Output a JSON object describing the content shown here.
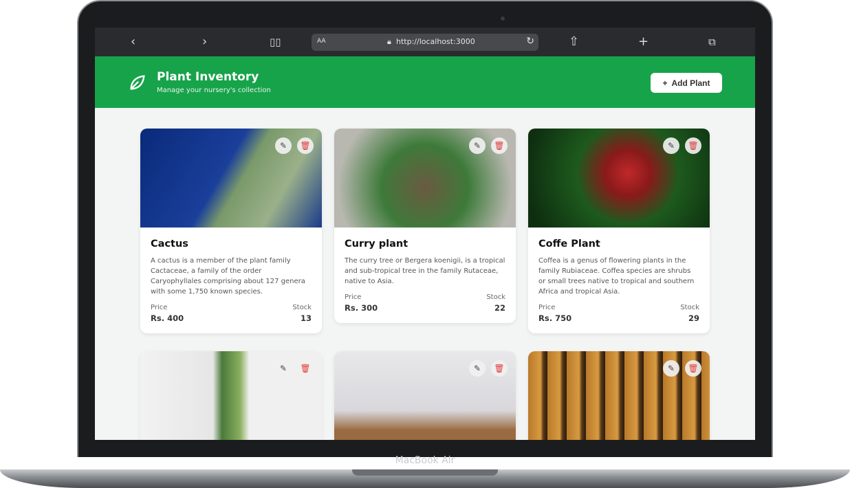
{
  "device": {
    "label": "MacBook Air"
  },
  "browser": {
    "url": "http://localhost:3000",
    "reader_label": "AA"
  },
  "header": {
    "title": "Plant Inventory",
    "subtitle": "Manage your nursery's collection",
    "add_label": "Add Plant"
  },
  "plants": [
    {
      "name": "Cactus",
      "description": "A cactus is a member of the plant family Cactaceae, a family of the order Caryophyllales comprising about 127 genera with some 1,750 known species.",
      "price_label": "Price",
      "price": "Rs. 400",
      "stock_label": "Stock",
      "stock": "13"
    },
    {
      "name": "Curry plant",
      "description": "The curry tree or Bergera koenigii, is a tropical and sub-tropical tree in the family Rutaceae, native to Asia.",
      "price_label": "Price",
      "price": "Rs. 300",
      "stock_label": "Stock",
      "stock": "22"
    },
    {
      "name": "Coffe Plant",
      "description": "Coffea is a genus of flowering plants in the family Rubiaceae. Coffea species are shrubs or small trees native to tropical and southern Africa and tropical Asia.",
      "price_label": "Price",
      "price": "Rs. 750",
      "stock_label": "Stock",
      "stock": "29"
    }
  ],
  "colors": {
    "brand": "#17a34a",
    "delete": "#e03a3a"
  }
}
